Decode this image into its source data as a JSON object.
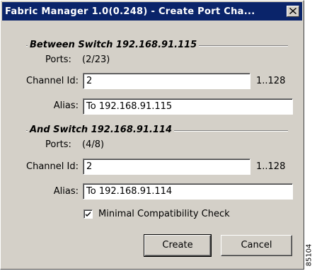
{
  "window": {
    "title": "Fabric Manager 1.0(0.248) - Create Port Cha...",
    "close_icon": "close-icon"
  },
  "group1": {
    "title": "Between Switch 192.168.91.115",
    "ports_label": "Ports:",
    "ports_value": "(2/23)",
    "channel_label": "Channel Id:",
    "channel_value": "2",
    "range": "1..128",
    "alias_label": "Alias:",
    "alias_value": "To 192.168.91.115"
  },
  "group2": {
    "title": "And Switch 192.168.91.114",
    "ports_label": "Ports:",
    "ports_value": "(4/8)",
    "channel_label": "Channel Id:",
    "channel_value": "2",
    "range": "1..128",
    "alias_label": "Alias:",
    "alias_value": "To 192.168.91.114"
  },
  "checkbox": {
    "label": "Minimal Compatibility Check",
    "checked": true
  },
  "buttons": {
    "create": "Create",
    "cancel": "Cancel"
  },
  "figure_id": "85104",
  "colors": {
    "title_bar": "#0a246a",
    "dialog_bg": "#d4d0c8"
  }
}
